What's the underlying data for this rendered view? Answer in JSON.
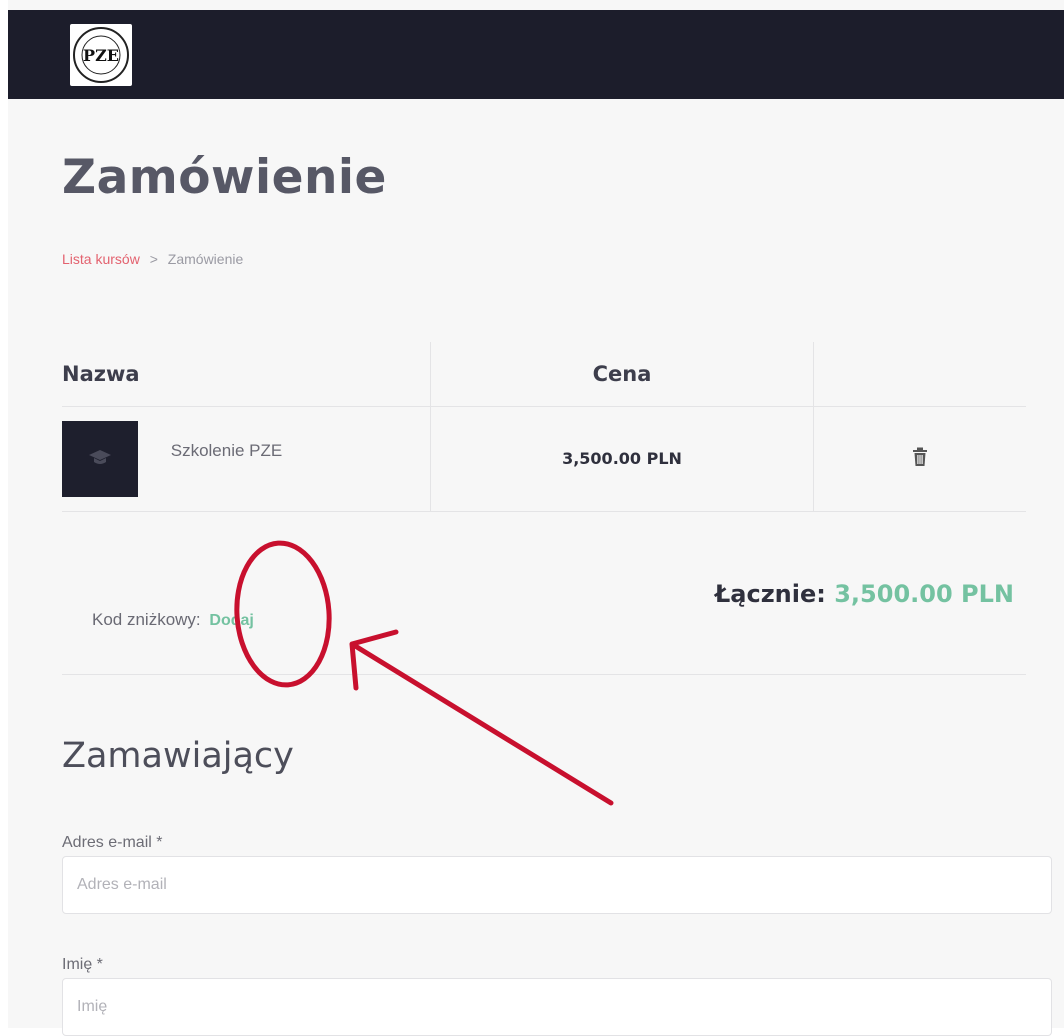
{
  "header": {
    "logo_text": "PZE"
  },
  "page": {
    "title": "Zamówienie"
  },
  "breadcrumb": {
    "items": [
      "Lista kursów",
      "Zamówienie"
    ],
    "separator": ">"
  },
  "cart": {
    "columns": [
      "Nazwa",
      "Cena",
      ""
    ],
    "rows": [
      {
        "name": "Szkolenie PZE",
        "price": "3,500.00 PLN",
        "thumb_icon": "graduation-cap-icon",
        "action_icon": "trash-icon"
      }
    ]
  },
  "summary": {
    "discount_label": "Kod zniżkowy:",
    "discount_action": "Dodaj",
    "total_label": "Łącznie:",
    "total_value": "3,500.00 PLN"
  },
  "customer": {
    "heading": "Zamawiający",
    "fields": [
      {
        "label": "Adres e-mail *",
        "placeholder": "Adres e-mail"
      },
      {
        "label": "Imię *",
        "placeholder": "Imię"
      }
    ]
  },
  "colors": {
    "accent_green": "#74c2a1",
    "link_red": "#e3626f",
    "topbar": "#1c1d2b",
    "annotation_red": "#c8102e"
  }
}
